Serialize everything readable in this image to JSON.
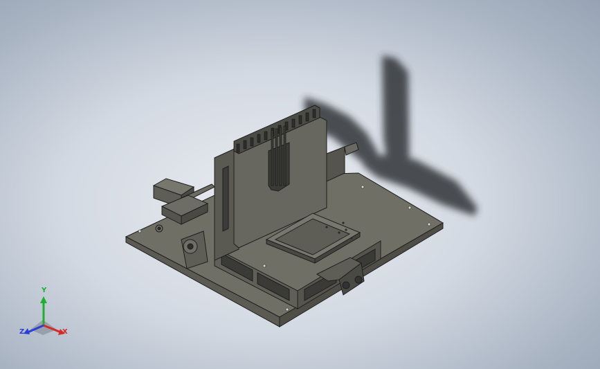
{
  "window": {
    "title": "",
    "background_colors": [
      "#e9ecf1",
      "#97a3b4"
    ]
  },
  "model": {
    "part_color": "#6f6f66",
    "edge_color": "#1e1e1e",
    "shadow_color": "#2a2e33"
  },
  "triad": {
    "x_label": "X",
    "y_label": "Y",
    "z_label": "Z",
    "x_color": "#d42a2a",
    "y_color": "#1fae2d",
    "z_color": "#2a3fd4"
  }
}
